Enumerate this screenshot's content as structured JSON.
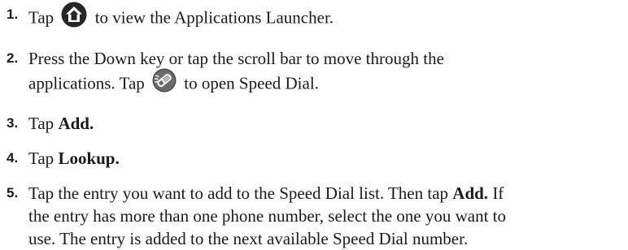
{
  "steps": [
    {
      "number": "1.",
      "before_icon": "Tap",
      "icon": "home-icon",
      "after_icon": "to view the Applications Launcher."
    },
    {
      "number": "2.",
      "line1": "Press the Down key or tap the scroll bar to move through the",
      "line2_before_icon": "applications. Tap",
      "icon": "speed-dial-phone-icon",
      "line2_after_icon": "to open Speed Dial."
    },
    {
      "number": "3.",
      "prefix": "Tap",
      "bold": "Add."
    },
    {
      "number": "4.",
      "prefix": "Tap",
      "bold": "Lookup."
    },
    {
      "number": "5.",
      "line1_a": "Tap the entry you want to add to the Speed Dial list. Then tap",
      "line1_bold": "Add.",
      "line1_b": "If",
      "line2": "the entry has more than one phone number, select the one you want to",
      "line3": "use. The entry is added to the next available Speed Dial number."
    }
  ]
}
